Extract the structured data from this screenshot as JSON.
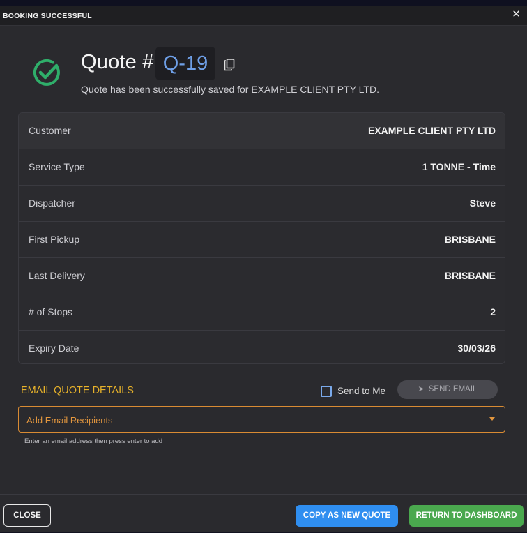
{
  "dialog": {
    "title": "BOOKING SUCCESSFUL",
    "close_glyph": "✕"
  },
  "header": {
    "quote_label": "Quote #",
    "quote_id": "Q-19",
    "subtitle": "Quote has been successfully saved for EXAMPLE CLIENT PTY LTD.",
    "success_icon": "check-circle-icon",
    "copy_icon": "copy-icon"
  },
  "details": [
    {
      "label": "Customer",
      "value": "EXAMPLE CLIENT PTY LTD"
    },
    {
      "label": "Service Type",
      "value": "1 TONNE - Time"
    },
    {
      "label": "Dispatcher",
      "value": "Steve"
    },
    {
      "label": "First Pickup",
      "value": "BRISBANE"
    },
    {
      "label": "Last Delivery",
      "value": "BRISBANE"
    },
    {
      "label": "# of Stops",
      "value": "2"
    },
    {
      "label": "Expiry Date",
      "value": "30/03/26"
    }
  ],
  "email": {
    "heading": "EMAIL QUOTE DETAILS",
    "send_to_me_label": "Send to Me",
    "send_to_me_checked": false,
    "send_button_label": "SEND EMAIL",
    "send_button_icon": "paper-plane-icon",
    "recipients_value": "",
    "recipients_placeholder": "Add Email Recipients",
    "hint": "Enter an email address then press enter to add"
  },
  "footer": {
    "close_label": "CLOSE",
    "copy_label": "COPY AS NEW QUOTE",
    "return_label": "RETURN TO DASHBOARD"
  },
  "colors": {
    "accent_orange": "#e7b22a",
    "input_border": "#d98b33",
    "primary_blue": "#2f8ef0",
    "success_green": "#4aa84e",
    "check_green": "#2fae6a",
    "quote_id_blue": "#6fa0e8"
  }
}
